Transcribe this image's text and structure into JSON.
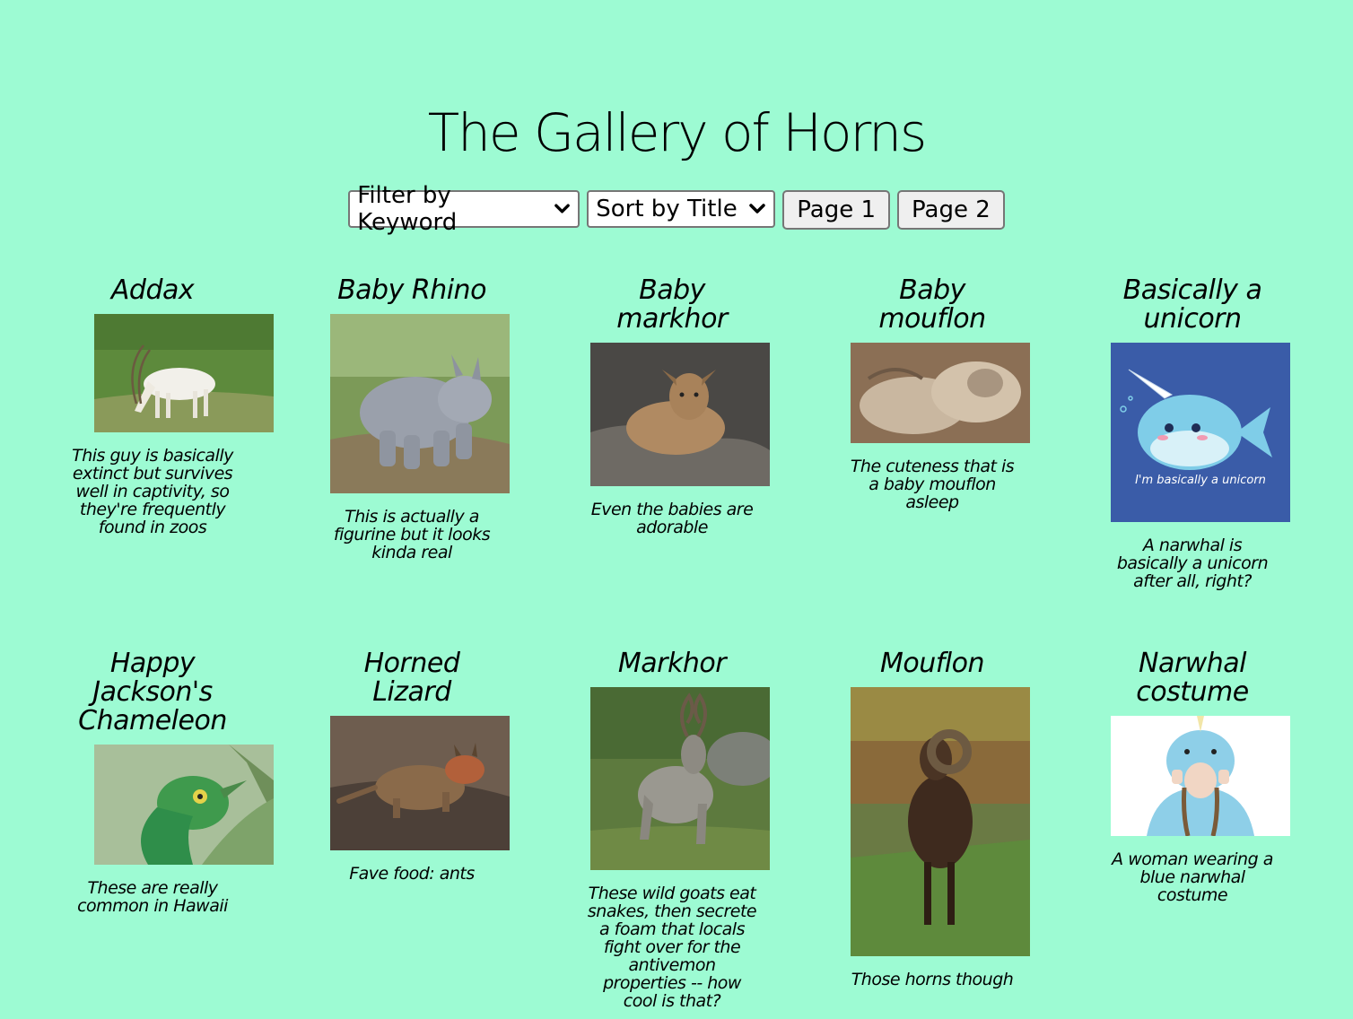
{
  "title": "The Gallery of Horns",
  "controls": {
    "filter_label": "Filter by Keyword",
    "sort_label": "Sort by Title",
    "page1_label": "Page 1",
    "page2_label": "Page 2"
  },
  "cards": [
    {
      "title": "Addax",
      "description": "This guy is basically extinct but survives well in captivity, so they're frequently found in zoos"
    },
    {
      "title": "Baby Rhino",
      "description": "This is actually a figurine but it looks kinda real"
    },
    {
      "title": "Baby markhor",
      "description": "Even the babies are adorable"
    },
    {
      "title": "Baby mouflon",
      "description": "The cuteness that is a baby mouflon asleep"
    },
    {
      "title": "Basically a unicorn",
      "description": "A narwhal is basically a unicorn after all, right?",
      "image_text": "I'm basically a unicorn"
    },
    {
      "title": "Happy Jackson's Chameleon",
      "description": "These are really common in Hawaii"
    },
    {
      "title": "Horned Lizard",
      "description": "Fave food: ants"
    },
    {
      "title": "Markhor",
      "description": "These wild goats eat snakes, then secrete a foam that locals fight over for the antivemon properties -- how cool is that?"
    },
    {
      "title": "Mouflon",
      "description": "Those horns though"
    },
    {
      "title": "Narwhal costume",
      "description": "A woman wearing a blue narwhal costume"
    }
  ],
  "colors": {
    "background": "#9dfbd3",
    "unicorn_bg": "#3a5ca8"
  }
}
